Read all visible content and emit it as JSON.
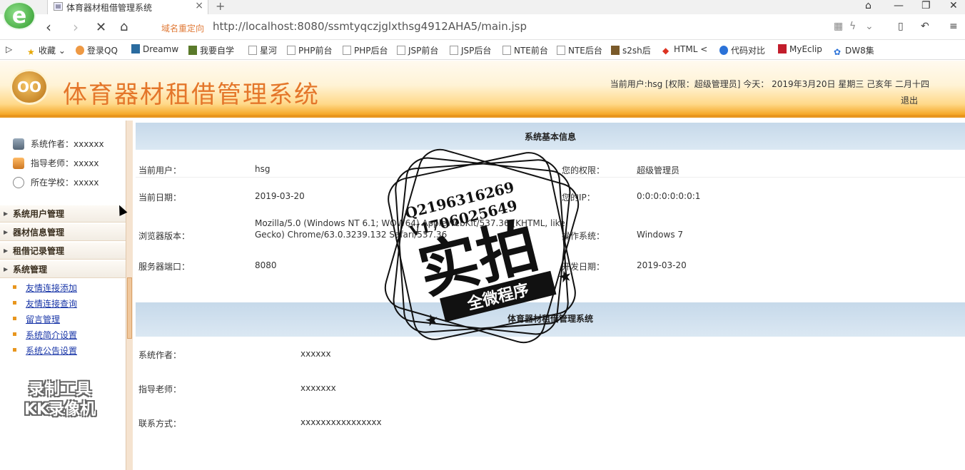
{
  "browser": {
    "tab_title": "体育器材租借管理系统",
    "tab_close": "×",
    "new_tab": "+",
    "redirect_label": "域名重定向",
    "url": "http://localhost:8080/ssmtyqczjglxthsg4912AHA5/main.jsp",
    "bookmarks": [
      "收藏",
      "登录QQ",
      "Dreamw",
      "我要自学",
      "星河",
      "PHP前台",
      "PHP后台",
      "JSP前台",
      "JSP后台",
      "NTE前台",
      "NTE后台",
      "s2sh后",
      "HTML <",
      "代码对比",
      "MyEclip",
      "DW8集"
    ]
  },
  "header": {
    "logo_glyph": "OO",
    "title": "体育器材租借管理系统",
    "user_info": "当前用户:hsg [权限：超级管理员] 今天： 2019年3月20日 星期三 己亥年 二月十四",
    "logout": "退出"
  },
  "sidebar": {
    "info": [
      {
        "label": "系统作者：xxxxxx",
        "icon": "author-icon"
      },
      {
        "label": "指导老师：xxxxx",
        "icon": "teacher-icon"
      },
      {
        "label": "所在学校：xxxxx",
        "icon": "school-icon"
      }
    ],
    "menus": [
      {
        "label": "系统用户管理"
      },
      {
        "label": "器材信息管理"
      },
      {
        "label": "租借记录管理"
      },
      {
        "label": "系统管理"
      }
    ],
    "sub_items": [
      "友情连接添加",
      "友情连接查询",
      "留言管理",
      "系统简介设置",
      "系统公告设置"
    ],
    "watermark_line1": "录制工具",
    "watermark_line2": "KK录像机"
  },
  "main": {
    "section1_title": "系统基本信息",
    "current_user_label": "当前用户：",
    "current_user": "hsg",
    "permission_label": "您的权限：",
    "permission": "超级管理员",
    "date_label": "当前日期：",
    "date": "2019-03-20",
    "ip_label": "您的IP：",
    "ip": "0:0:0:0:0:0:0:1",
    "browser_label": "浏览器版本：",
    "browser_line1": "Mozilla/5.0 (Windows NT 6.1; WOW64) AppleWebKit/537.36 (KHTML, like",
    "browser_line2": "Gecko) Chrome/63.0.3239.132 Safari/537.36",
    "os_label": "操作系统：",
    "os": "Windows 7",
    "port_label": "服务器端口：",
    "port": "8080",
    "dev_date_label": "开发日期：",
    "dev_date": "2019-03-20",
    "section2_title": "体育器材租借管理系统",
    "author_label": "系统作者：",
    "author": "xxxxxx",
    "teacher_label": "指导老师：",
    "teacher": "xxxxxxx",
    "contact_label": "联系方式：",
    "contact": "xxxxxxxxxxxxxxxx"
  },
  "stamp": {
    "qq": "Q2196316269",
    "v": "V1706025649",
    "big": "实拍",
    "ribbon": "全微程序"
  }
}
